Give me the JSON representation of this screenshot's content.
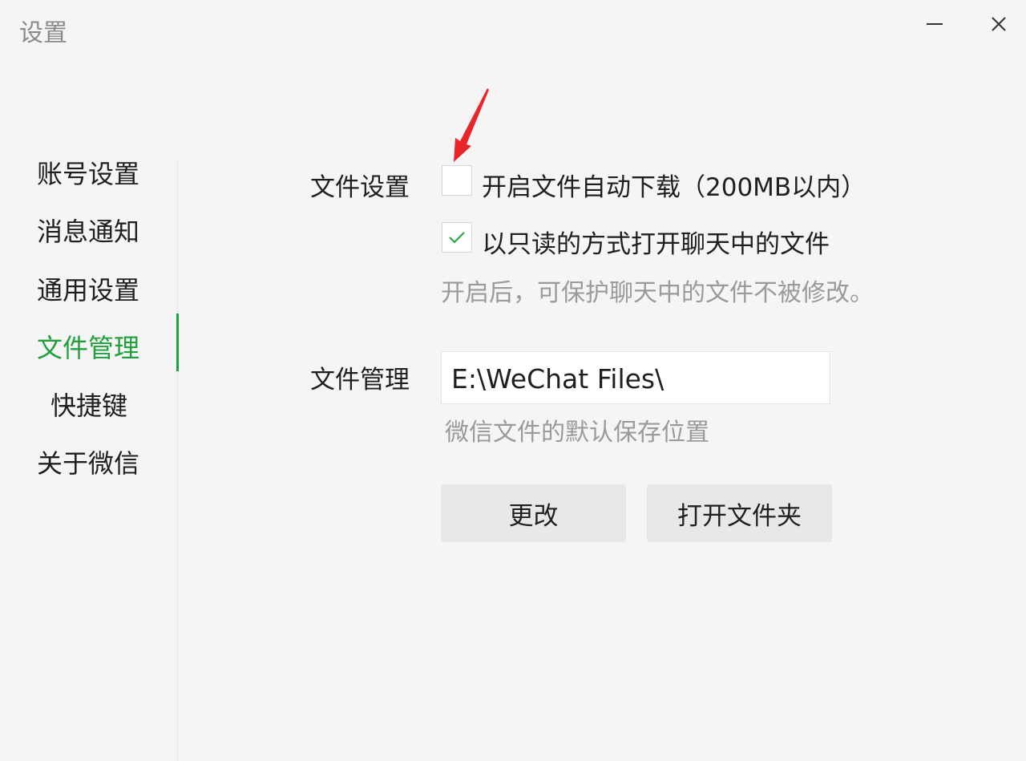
{
  "window": {
    "title": "设置",
    "minimize_icon": "minimize-icon",
    "close_icon": "close-icon",
    "close_glyph": "✕"
  },
  "sidebar": {
    "items": [
      {
        "label": "账号设置",
        "active": false
      },
      {
        "label": "消息通知",
        "active": false
      },
      {
        "label": "通用设置",
        "active": false
      },
      {
        "label": "文件管理",
        "active": true
      },
      {
        "label": "快捷键",
        "active": false
      },
      {
        "label": "关于微信",
        "active": false
      }
    ],
    "accent_color": "#20a03c"
  },
  "file_settings": {
    "label": "文件设置",
    "auto_download": {
      "label": "开启文件自动下载（200MB以内）",
      "checked": false
    },
    "read_only": {
      "label": "以只读的方式打开聊天中的文件",
      "checked": true
    },
    "read_only_hint": "开启后，可保护聊天中的文件不被修改。"
  },
  "file_management": {
    "label": "文件管理",
    "path_value": "E:\\WeChat Files\\",
    "path_hint": "微信文件的默认保存位置",
    "change_button": "更改",
    "open_folder_button": "打开文件夹"
  },
  "annotation": {
    "arrow_color": "#e8262a"
  }
}
